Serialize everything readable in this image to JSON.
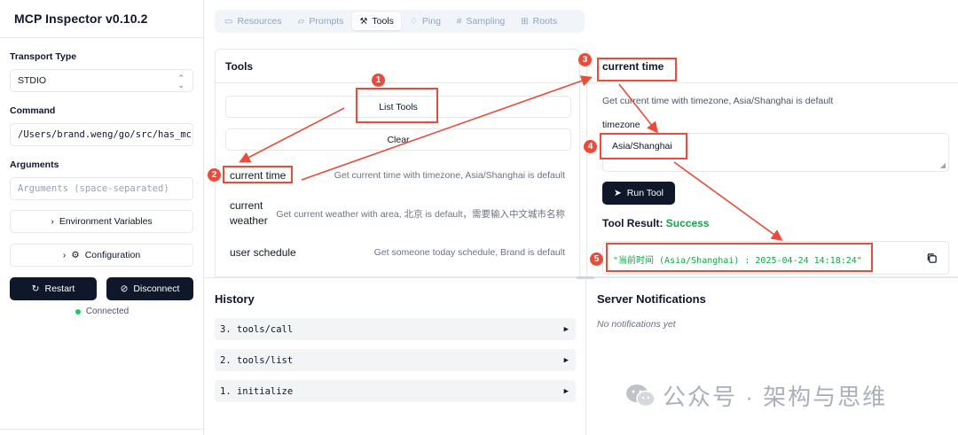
{
  "app": {
    "title": "MCP Inspector v0.10.2"
  },
  "sidebar": {
    "transport_label": "Transport Type",
    "transport_value": "STDIO",
    "command_label": "Command",
    "command_value": "/Users/brand.weng/go/src/has_mc",
    "arguments_label": "Arguments",
    "arguments_placeholder": "Arguments (space-separated)",
    "env_button": "Environment Variables",
    "config_button": "Configuration",
    "restart_button": "Restart",
    "disconnect_button": "Disconnect",
    "status": "Connected"
  },
  "tabs": [
    {
      "label": "Resources",
      "icon": "file-icon",
      "active": false
    },
    {
      "label": "Prompts",
      "icon": "message-icon",
      "active": false
    },
    {
      "label": "Tools",
      "icon": "hammer-icon",
      "active": true
    },
    {
      "label": "Ping",
      "icon": "bell-icon",
      "active": false
    },
    {
      "label": "Sampling",
      "icon": "hash-icon",
      "active": false
    },
    {
      "label": "Roots",
      "icon": "folder-tree-icon",
      "active": false
    }
  ],
  "tools_panel": {
    "title": "Tools",
    "list_button": "List Tools",
    "clear_button": "Clear",
    "tools": [
      {
        "name": "current time",
        "description": "Get current time with timezone, Asia/Shanghai is default"
      },
      {
        "name": "current weather",
        "description": "Get current weather with area, 北京 is default，需要输入中文城市名称"
      },
      {
        "name": "user schedule",
        "description": "Get someone today schedule, Brand is default"
      }
    ]
  },
  "tool_detail": {
    "title": "current time",
    "description": "Get current time with timezone, Asia/Shanghai is default",
    "param_label": "timezone",
    "param_value": "Asia/Shanghai",
    "run_button": "Run Tool",
    "result_label": "Tool Result:",
    "result_status": "Success",
    "result_value": "\"当前时间 (Asia/Shanghai) : 2025-04-24 14:18:24\""
  },
  "history": {
    "title": "History",
    "items": [
      "3. tools/call",
      "2. tools/list",
      "1. initialize"
    ]
  },
  "notifications": {
    "title": "Server Notifications",
    "empty": "No notifications yet"
  },
  "watermark": {
    "text": "公众号 · 架构与思维"
  },
  "annotations": {
    "badges": [
      "1",
      "2",
      "3",
      "4",
      "5"
    ],
    "color": "#e74c3c"
  },
  "colors": {
    "primary_dark": "#0f172a",
    "success": "#16a34a",
    "status_green": "#22c55e"
  }
}
